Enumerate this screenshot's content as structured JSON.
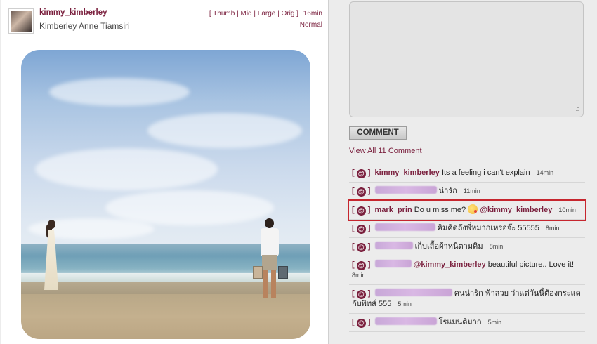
{
  "post": {
    "username": "kimmy_kimberley",
    "fullname": "Kimberley Anne Tiamsiri",
    "size_links": [
      "Thumb",
      "Mid",
      "Large",
      "Orig"
    ],
    "time": "16min",
    "mode": "Normal"
  },
  "comment_panel": {
    "resize_glyph": ".::",
    "button_label": "COMMENT",
    "view_all": "View All 11 Comment",
    "at_label": "@",
    "comments": [
      {
        "user": "kimmy_kimberley",
        "text": "Its a feeling i can't explain",
        "time": "14min"
      },
      {
        "user": "",
        "text": "น่ารัก",
        "time": "11min"
      },
      {
        "user": "mark_prin",
        "text": "Do u miss me?",
        "mention": "@kimmy_kimberley",
        "time": "10min"
      },
      {
        "user": "",
        "text": "คิมคิดถึงพี่หมากเหรอจ๊ะ 55555",
        "time": "8min"
      },
      {
        "user": "",
        "text": "เก็บเสื้อผ้าหนีตามคิม",
        "time": "8min"
      },
      {
        "user": "",
        "mention": "@kimmy_kimberley",
        "text": "beautiful picture.. Love it!",
        "time": "8min"
      },
      {
        "user": "",
        "text": "คนน่ารัก ฟ้าสวย ว่าแต่วันนี้ต้องกระแดกับพิทส์ 555",
        "time": "5min"
      },
      {
        "user": "",
        "text": "โรแมนติมาก",
        "time": "5min"
      }
    ]
  },
  "colors": {
    "accent": "#7a1f3d",
    "highlight_border": "#c6262e"
  }
}
